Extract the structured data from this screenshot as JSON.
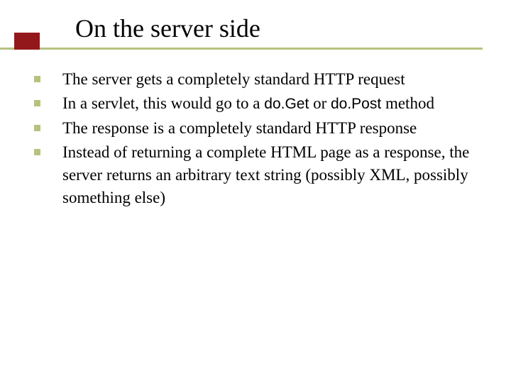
{
  "title": "On the server side",
  "bullets": {
    "b0": "The server gets a completely standard HTTP request",
    "b1_pre": "In a servlet, this would go to a ",
    "b1_code1": "do.Get",
    "b1_mid": " or ",
    "b1_code2": "do.Post",
    "b1_post": " method",
    "b2": "The response is a completely standard HTTP response",
    "b3": "Instead of returning a complete HTML page as a response, the server returns an arbitrary text string (possibly XML, possibly something else)"
  }
}
